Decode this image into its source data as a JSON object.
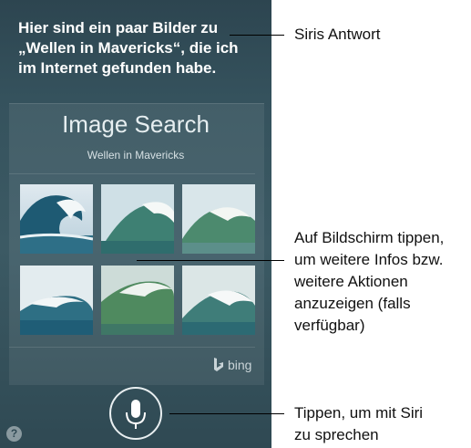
{
  "siri_response": {
    "lines": [
      "Hier sind ein paar Bilder zu",
      "„Wellen in Mavericks“, die ich",
      "im Internet gefunden habe."
    ]
  },
  "image_search": {
    "title": "Image Search",
    "query": "Wellen in Mavericks",
    "thumbnails": [
      "wave-image",
      "wave-image",
      "wave-image",
      "wave-image",
      "wave-image",
      "wave-image"
    ],
    "provider": "bing"
  },
  "controls": {
    "mic_icon": "microphone-icon",
    "help_label": "?"
  },
  "callouts": {
    "siri_answer": [
      "Siris Antwort"
    ],
    "tap_screen": [
      "Auf Bildschirm tippen,",
      "um weitere Infos bzw.",
      "weitere Aktionen",
      "anzuzeigen (falls",
      "verfügbar)"
    ],
    "tap_mic": [
      "Tippen, um mit Siri",
      "zu sprechen"
    ]
  },
  "colors": {
    "background": "#3c5a64",
    "text": "#ffffff",
    "callout_text": "#111111"
  }
}
